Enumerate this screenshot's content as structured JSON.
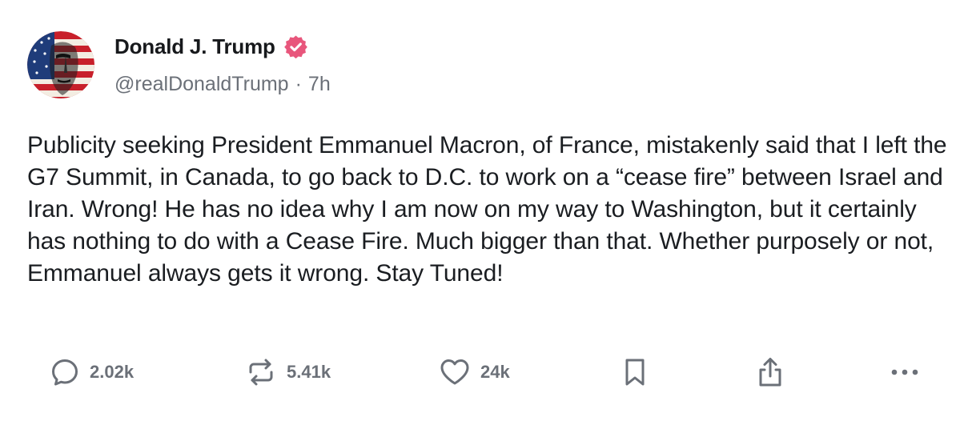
{
  "post": {
    "author": {
      "display_name": "Donald J. Trump",
      "handle": "@realDonaldTrump",
      "verified_icon": "verified-badge-icon",
      "badge_color": "#e8567c"
    },
    "separator": "·",
    "time_ago": "7h",
    "text": "Publicity seeking President Emmanuel Macron, of France, mistakenly said that I left the G7 Summit, in Canada, to go back to D.C. to work on a “cease fire” between Israel and Iran. Wrong! He has no idea why I am now on my way to Washington, but it certainly has nothing to do with a Cease Fire. Much bigger than that. Whether purposely or not, Emmanuel always gets it wrong. Stay Tuned!",
    "actions": {
      "replies": {
        "icon": "reply-bubble-icon",
        "count": "2.02k"
      },
      "reposts": {
        "icon": "repost-icon",
        "count": "5.41k"
      },
      "likes": {
        "icon": "heart-icon",
        "count": "24k"
      },
      "bookmark": {
        "icon": "bookmark-icon"
      },
      "share": {
        "icon": "share-icon"
      },
      "more": {
        "icon": "more-dots-icon"
      }
    }
  },
  "colors": {
    "text": "#1a1d21",
    "muted": "#6b7078",
    "icon": "#6b7078"
  }
}
